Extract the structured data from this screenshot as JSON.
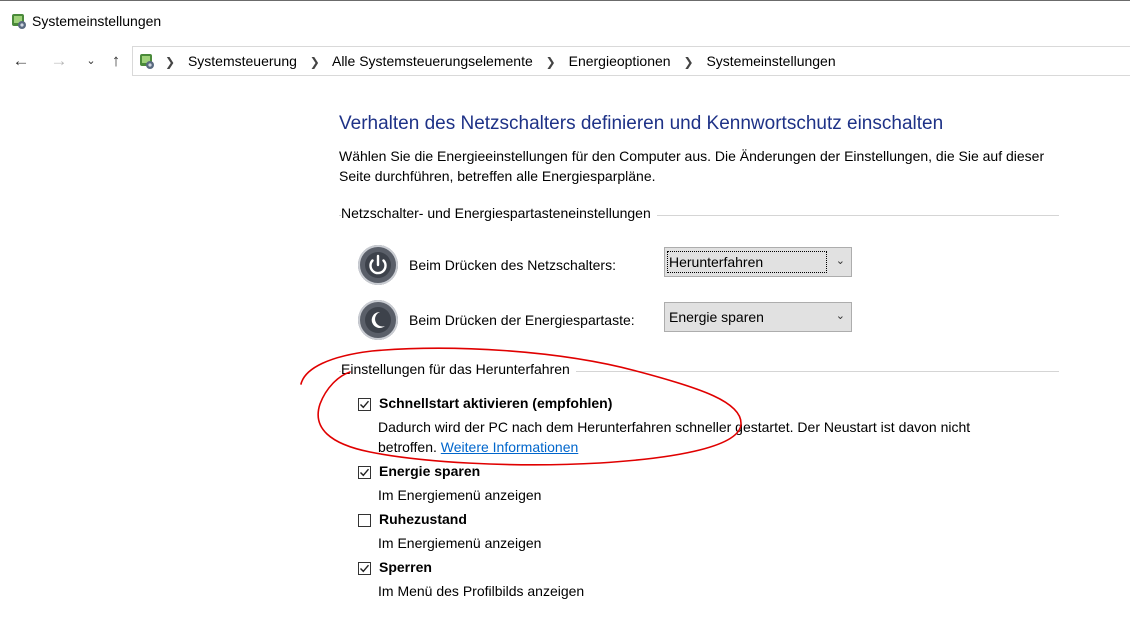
{
  "window": {
    "title": "Systemeinstellungen"
  },
  "navigation": {
    "back_icon": "arrow-left-icon",
    "forward_icon": "arrow-right-icon",
    "recent_icon": "chevron-down-icon",
    "up_icon": "arrow-up-icon",
    "breadcrumb": [
      "Systemsteuerung",
      "Alle Systemsteuerungselemente",
      "Energieoptionen",
      "Systemeinstellungen"
    ]
  },
  "main": {
    "heading": "Verhalten des Netzschalters definieren und Kennwortschutz einschalten",
    "intro": "Wählen Sie die Energieeinstellungen für den Computer aus. Die Änderungen der Einstellungen, die Sie auf dieser Seite durchführen, betreffen alle Energiesparpläne.",
    "buttons_group_label": "Netzschalter- und Energiespartasteneinstellungen",
    "power_button": {
      "label": "Beim Drücken des Netzschalters:",
      "value": "Herunterfahren"
    },
    "sleep_button": {
      "label": "Beim Drücken der Energiespartaste:",
      "value": "Energie sparen"
    },
    "shutdown_group_label": "Einstellungen für das Herunterfahren",
    "options": [
      {
        "title": "Schnellstart aktivieren (empfohlen)",
        "desc": "Dadurch wird der PC nach dem Herunterfahren schneller gestartet. Der Neustart ist davon nicht betroffen.",
        "link": "Weitere Informationen",
        "checked": true
      },
      {
        "title": "Energie sparen",
        "desc": "Im Energiemenü anzeigen",
        "checked": true
      },
      {
        "title": "Ruhezustand",
        "desc": "Im Energiemenü anzeigen",
        "checked": false
      },
      {
        "title": "Sperren",
        "desc": "Im Menü des Profilbilds anzeigen",
        "checked": true
      }
    ]
  },
  "colors": {
    "heading": "#1e3287",
    "link": "#0066cc",
    "annotation": "#e00000"
  }
}
